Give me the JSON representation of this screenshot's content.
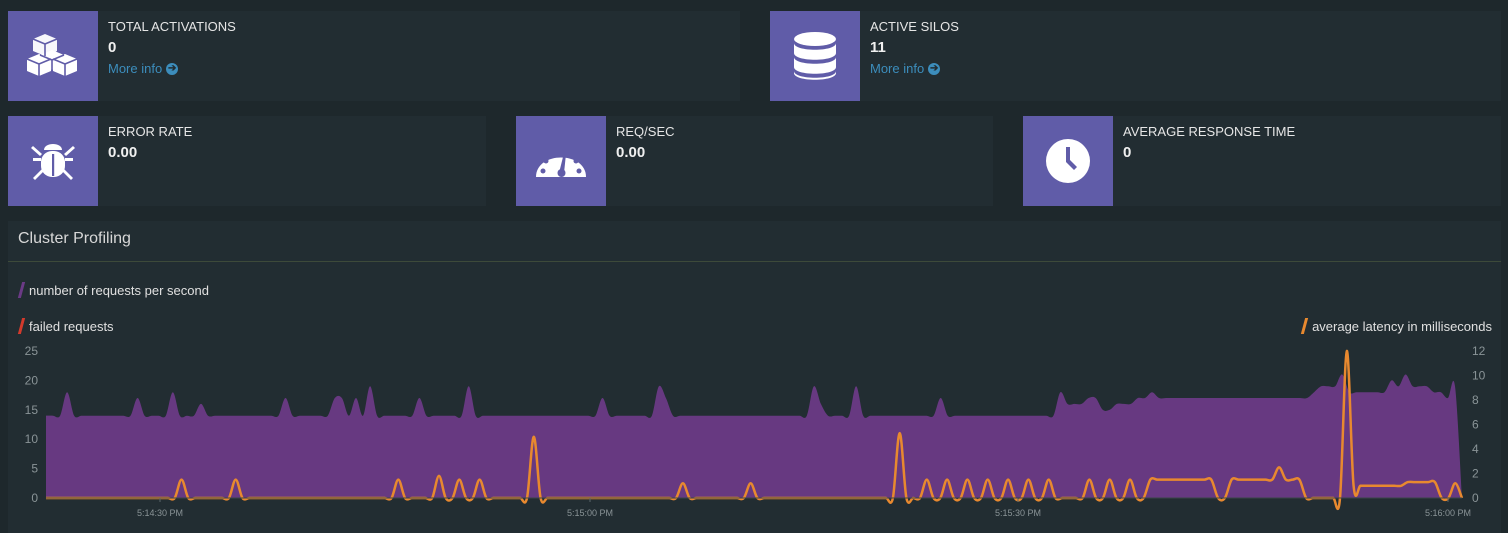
{
  "stats": {
    "total_activations": {
      "label": "TOTAL ACTIVATIONS",
      "value": "0",
      "more": "More info",
      "icon": "cubes-icon"
    },
    "active_silos": {
      "label": "ACTIVE SILOS",
      "value": "11",
      "more": "More info",
      "icon": "database-icon"
    },
    "error_rate": {
      "label": "ERROR RATE",
      "value": "0.00",
      "icon": "bug-icon"
    },
    "req_sec": {
      "label": "REQ/SEC",
      "value": "0.00",
      "icon": "dashboard-icon"
    },
    "avg_response": {
      "label": "AVERAGE RESPONSE TIME",
      "value": "0",
      "icon": "clock-icon"
    }
  },
  "colors": {
    "accent": "#605ca8",
    "link": "#3c8dbc",
    "requests": "#6b3a86",
    "failed": "#d33a2c",
    "latency": "#e8892f"
  },
  "panel": {
    "title": "Cluster Profiling"
  },
  "chart_data": {
    "type": "area",
    "legend": {
      "requests": "number of requests per second",
      "failed": "failed requests",
      "latency": "average latency in milliseconds"
    },
    "y_left_ticks": [
      0,
      5,
      10,
      15,
      20,
      25
    ],
    "y_left_lim": [
      0,
      25
    ],
    "y_right_ticks": [
      0,
      2,
      4,
      6,
      8,
      10,
      12
    ],
    "y_right_lim": [
      0,
      12
    ],
    "x_ticks": [
      "5:14:30 PM",
      "5:15:00 PM",
      "5:15:30 PM",
      "5:16:00 PM"
    ],
    "series": [
      {
        "name": "number of requests per second",
        "axis": "left",
        "values": [
          14,
          14,
          14,
          18,
          14,
          14,
          14,
          14,
          14,
          14,
          14,
          14,
          14,
          17,
          14,
          14,
          14,
          14,
          18,
          14,
          14,
          14,
          16,
          14,
          14,
          14,
          14,
          14,
          14,
          14,
          14,
          14,
          14,
          14,
          17,
          14,
          14,
          14,
          14,
          14,
          14,
          17,
          17,
          14,
          17,
          14,
          19,
          14,
          14,
          14,
          14,
          14,
          14,
          17,
          14,
          14,
          14,
          14,
          14,
          14,
          19,
          14,
          14,
          14,
          14,
          14,
          14,
          14,
          14,
          14,
          14,
          14,
          14,
          14,
          14,
          14,
          14,
          14,
          14,
          17,
          14,
          14,
          14,
          14,
          14,
          14,
          14,
          19,
          17,
          14,
          14,
          14,
          14,
          14,
          14,
          14,
          14,
          14,
          14,
          14,
          14,
          14,
          14,
          14,
          14,
          14,
          14,
          14,
          14,
          19,
          16,
          14,
          14,
          14,
          14,
          19,
          14,
          14,
          14,
          14,
          14,
          14,
          14,
          14,
          14,
          14,
          14,
          17,
          14,
          14,
          14,
          14,
          14,
          14,
          14,
          14,
          14,
          14,
          14,
          14,
          14,
          14,
          14,
          14,
          18,
          16,
          16,
          16,
          17,
          17,
          15,
          15,
          16,
          16,
          16,
          17,
          17,
          18,
          17,
          17,
          17,
          17,
          17,
          17,
          17,
          17,
          17,
          17,
          17,
          17,
          17,
          17,
          17,
          17,
          17,
          17,
          17,
          17,
          17,
          17,
          18,
          19,
          19,
          19,
          21,
          18,
          18,
          18,
          18,
          18,
          18,
          20,
          19,
          21,
          19,
          19,
          19,
          18,
          18,
          17,
          19,
          0
        ]
      },
      {
        "name": "failed requests",
        "axis": "left",
        "values": []
      },
      {
        "name": "average latency in milliseconds",
        "axis": "right",
        "values": [
          0,
          0,
          0,
          0,
          0,
          0,
          0,
          0,
          0,
          0,
          0,
          0,
          0,
          0,
          0,
          0,
          0,
          0,
          0,
          0,
          1.5,
          0,
          0,
          0,
          0,
          0,
          0,
          0,
          1.5,
          0,
          0,
          0,
          0,
          0,
          0,
          0,
          0,
          0,
          0,
          0,
          0,
          0,
          0,
          0,
          0,
          0,
          0,
          0,
          0,
          0,
          0,
          0,
          1.5,
          0,
          0,
          0,
          0,
          0,
          1.8,
          0,
          0,
          1.5,
          0,
          0,
          1.5,
          0,
          0,
          0,
          0,
          0,
          0,
          0,
          5,
          0,
          0,
          0,
          0,
          0,
          0,
          0,
          0,
          0,
          0,
          0,
          0,
          0,
          0,
          0,
          0,
          0,
          0,
          0,
          0,
          0,
          1.2,
          0,
          0,
          0,
          0,
          0,
          0,
          0,
          0,
          0,
          1.2,
          0,
          0,
          0,
          0,
          0,
          0,
          0,
          0,
          0,
          0,
          0,
          0,
          0,
          0,
          0,
          0,
          0,
          0,
          0,
          0,
          0,
          5.3,
          0,
          0,
          0,
          1.5,
          0,
          0,
          1.5,
          0,
          0,
          1.5,
          0,
          0,
          1.5,
          0,
          0,
          1.5,
          0,
          0,
          1.5,
          0,
          0,
          1.5,
          0,
          0,
          0,
          0,
          0,
          1.5,
          0,
          0,
          1.5,
          0,
          0,
          1.5,
          0,
          0,
          1.5,
          1.5,
          1.5,
          1.5,
          1.5,
          1.5,
          1.5,
          1.5,
          1.5,
          1.5,
          0,
          0,
          1.5,
          1.5,
          1.5,
          1.5,
          1.5,
          1.5,
          1.5,
          2.5,
          1.5,
          1.5,
          1.5,
          0,
          0,
          0,
          0,
          0,
          0,
          12,
          1,
          1,
          1,
          1,
          1,
          1,
          1,
          1,
          1.3,
          1.3,
          1.3,
          1.3,
          1.3,
          0,
          0,
          1.2,
          0
        ]
      }
    ]
  }
}
